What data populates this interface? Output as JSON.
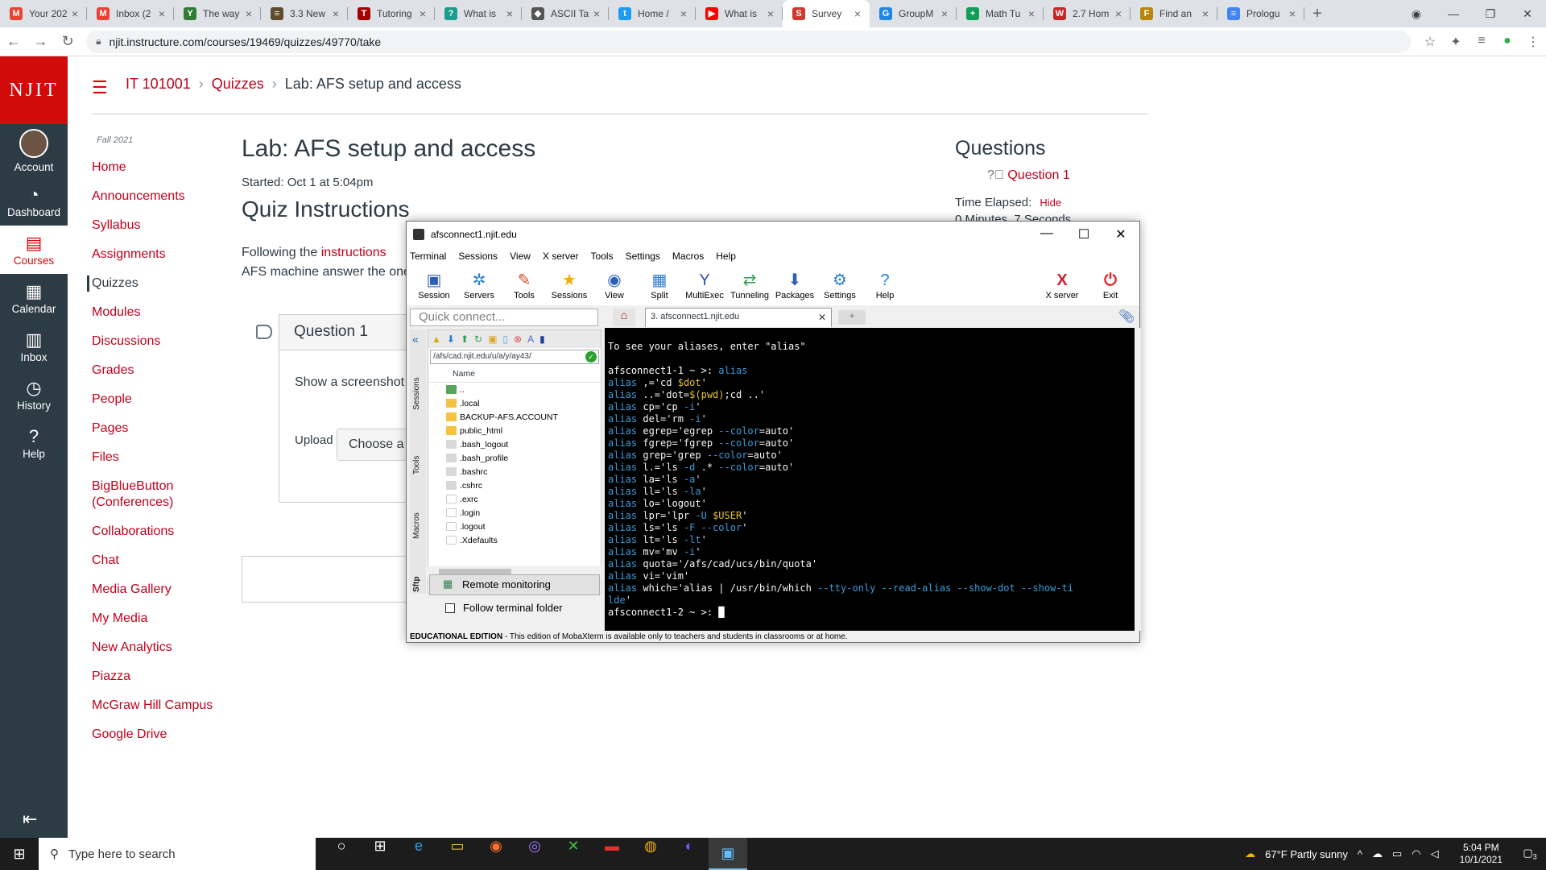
{
  "browser": {
    "tabs": [
      {
        "title": "Your 202",
        "fav": "M",
        "color": "#ea4335"
      },
      {
        "title": "Inbox (2",
        "fav": "M",
        "color": "#ea4335"
      },
      {
        "title": "The way",
        "fav": "Y",
        "color": "#2e7d32"
      },
      {
        "title": "3.3 New",
        "fav": "≡",
        "color": "#5f4b2e"
      },
      {
        "title": "Tutoring",
        "fav": "T",
        "color": "#a50000"
      },
      {
        "title": "What is",
        "fav": "?",
        "color": "#1a9c8c"
      },
      {
        "title": "ASCII Ta",
        "fav": "◆",
        "color": "#555555"
      },
      {
        "title": "Home /",
        "fav": "t",
        "color": "#1d9bf0"
      },
      {
        "title": "What is",
        "fav": "▶",
        "color": "#ff0000"
      },
      {
        "title": "Survey",
        "fav": "S",
        "color": "#d1392e"
      },
      {
        "title": "GroupM",
        "fav": "G",
        "color": "#1e88e5"
      },
      {
        "title": "Math Tu",
        "fav": "+",
        "color": "#0f9d58"
      },
      {
        "title": "2.7 Hom",
        "fav": "W",
        "color": "#c62828"
      },
      {
        "title": "Find an",
        "fav": "F",
        "color": "#b8860b"
      },
      {
        "title": "Prologu",
        "fav": "≡",
        "color": "#4285f4"
      }
    ],
    "url": "njit.instructure.com/courses/19469/quizzes/49770/take"
  },
  "global_nav": {
    "logo": "NJIT",
    "items": [
      {
        "label": "Account",
        "icon": "◯"
      },
      {
        "label": "Dashboard",
        "icon": "◔"
      },
      {
        "label": "Courses",
        "icon": "▤"
      },
      {
        "label": "Calendar",
        "icon": "▦"
      },
      {
        "label": "Inbox",
        "icon": "▥"
      },
      {
        "label": "History",
        "icon": "◷"
      },
      {
        "label": "Help",
        "icon": "?"
      }
    ]
  },
  "breadcrumb": {
    "course": "IT 101001",
    "section": "Quizzes",
    "page": "Lab: AFS setup and access"
  },
  "course_nav": {
    "term": "Fall 2021",
    "items": [
      "Home",
      "Announcements",
      "Syllabus",
      "Assignments",
      "Quizzes",
      "Modules",
      "Discussions",
      "Grades",
      "People",
      "Pages",
      "Files",
      "BigBlueButton (Conferences)",
      "Collaborations",
      "Chat",
      "Media Gallery",
      "My Media",
      "New Analytics",
      "Piazza",
      "McGraw Hill Campus",
      "Google Drive"
    ]
  },
  "quiz": {
    "title": "Lab: AFS setup and access",
    "started": "Started: Oct 1 at 5:04pm",
    "instructions_heading": "Quiz Instructions",
    "follow_prefix": "Following the ",
    "instructions_link": "instructions",
    "follow_rest": "AFS machine answer the one",
    "question_title": "Question 1",
    "question_text": "Show a screenshot",
    "upload_label": "Upload",
    "choose_button": "Choose a"
  },
  "sidebar": {
    "heading": "Questions",
    "question_link": "Question 1",
    "time_elapsed": "Time Elapsed:",
    "hide": "Hide",
    "elapsed_value": "0 Minutes, 7 Seconds"
  },
  "moba": {
    "title": "afsconnect1.njit.edu",
    "menu": [
      "Terminal",
      "Sessions",
      "View",
      "X server",
      "Tools",
      "Settings",
      "Macros",
      "Help"
    ],
    "toolbar": [
      {
        "label": "Session",
        "icon": "▣"
      },
      {
        "label": "Servers",
        "icon": "✲"
      },
      {
        "label": "Tools",
        "icon": "✎"
      },
      {
        "label": "Sessions",
        "icon": "★"
      },
      {
        "label": "View",
        "icon": "◉"
      },
      {
        "label": "Split",
        "icon": "▦"
      },
      {
        "label": "MultiExec",
        "icon": "Y"
      },
      {
        "label": "Tunneling",
        "icon": "⇄"
      },
      {
        "label": "Packages",
        "icon": "⬇"
      },
      {
        "label": "Settings",
        "icon": "⚙"
      },
      {
        "label": "Help",
        "icon": "?"
      }
    ],
    "toolbar_right": [
      {
        "label": "X server",
        "icon": "X"
      },
      {
        "label": "Exit",
        "icon": "⏻"
      }
    ],
    "quick_connect": "Quick connect...",
    "session_tab": "3. afsconnect1.njit.edu",
    "side_tabs": [
      "Sessions",
      "Tools",
      "Macros",
      "Sftp"
    ],
    "sftp_path": "/afs/cad.njit.edu/u/a/y/ay43/",
    "column_name": "Name",
    "files": [
      {
        "name": "..",
        "t": "u"
      },
      {
        "name": ".local",
        "t": "d"
      },
      {
        "name": "BACKUP-AFS.ACCOUNT",
        "t": "d"
      },
      {
        "name": "public_html",
        "t": "d"
      },
      {
        "name": ".bash_logout",
        "t": "f"
      },
      {
        "name": ".bash_profile",
        "t": "f"
      },
      {
        "name": ".bashrc",
        "t": "f"
      },
      {
        "name": ".cshrc",
        "t": "f"
      },
      {
        "name": ".exrc",
        "t": "w"
      },
      {
        "name": ".login",
        "t": "w"
      },
      {
        "name": ".logout",
        "t": "w"
      },
      {
        "name": ".Xdefaults",
        "t": "w"
      }
    ],
    "remote_monitoring": "Remote monitoring",
    "follow_folder": "Follow terminal folder",
    "status_bold": "EDUCATIONAL EDITION",
    "status_text": " - This edition of MobaXterm is available only to teachers and students in classrooms or at home.",
    "terminal_lines": [
      [
        {
          "t": "To see your aliases, enter \"alias\"",
          "c": "st"
        }
      ],
      [
        {
          "t": "",
          "c": "st"
        }
      ],
      [
        {
          "t": "afsconnect1-1 ~ >: ",
          "c": "pr"
        },
        {
          "t": "alias",
          "c": "kw"
        }
      ],
      [
        {
          "t": "alias ",
          "c": "kw"
        },
        {
          "t": ",='cd ",
          "c": "st"
        },
        {
          "t": "$dot",
          "c": "vr"
        },
        {
          "t": "'",
          "c": "st"
        }
      ],
      [
        {
          "t": "alias ",
          "c": "kw"
        },
        {
          "t": "..='dot=",
          "c": "st"
        },
        {
          "t": "$(pwd)",
          "c": "vr"
        },
        {
          "t": ";cd ..'",
          "c": "st"
        }
      ],
      [
        {
          "t": "alias ",
          "c": "kw"
        },
        {
          "t": "cp='cp ",
          "c": "st"
        },
        {
          "t": "-i",
          "c": "kw"
        },
        {
          "t": "'",
          "c": "st"
        }
      ],
      [
        {
          "t": "alias ",
          "c": "kw"
        },
        {
          "t": "del='rm ",
          "c": "st"
        },
        {
          "t": "-i",
          "c": "kw"
        },
        {
          "t": "'",
          "c": "st"
        }
      ],
      [
        {
          "t": "alias ",
          "c": "kw"
        },
        {
          "t": "egrep='egrep ",
          "c": "st"
        },
        {
          "t": "--color",
          "c": "kw"
        },
        {
          "t": "=auto'",
          "c": "st"
        }
      ],
      [
        {
          "t": "alias ",
          "c": "kw"
        },
        {
          "t": "fgrep='fgrep ",
          "c": "st"
        },
        {
          "t": "--color",
          "c": "kw"
        },
        {
          "t": "=auto'",
          "c": "st"
        }
      ],
      [
        {
          "t": "alias ",
          "c": "kw"
        },
        {
          "t": "grep='grep ",
          "c": "st"
        },
        {
          "t": "--color",
          "c": "kw"
        },
        {
          "t": "=auto'",
          "c": "st"
        }
      ],
      [
        {
          "t": "alias ",
          "c": "kw"
        },
        {
          "t": "l.='ls ",
          "c": "st"
        },
        {
          "t": "-d",
          "c": "kw"
        },
        {
          "t": " .* ",
          "c": "st"
        },
        {
          "t": "--color",
          "c": "kw"
        },
        {
          "t": "=auto'",
          "c": "st"
        }
      ],
      [
        {
          "t": "alias ",
          "c": "kw"
        },
        {
          "t": "la='ls ",
          "c": "st"
        },
        {
          "t": "-a",
          "c": "kw"
        },
        {
          "t": "'",
          "c": "st"
        }
      ],
      [
        {
          "t": "alias ",
          "c": "kw"
        },
        {
          "t": "ll='ls ",
          "c": "st"
        },
        {
          "t": "-la",
          "c": "kw"
        },
        {
          "t": "'",
          "c": "st"
        }
      ],
      [
        {
          "t": "alias ",
          "c": "kw"
        },
        {
          "t": "lo='logout'",
          "c": "st"
        }
      ],
      [
        {
          "t": "alias ",
          "c": "kw"
        },
        {
          "t": "lpr='lpr ",
          "c": "st"
        },
        {
          "t": "-U",
          "c": "kw"
        },
        {
          "t": " ",
          "c": "st"
        },
        {
          "t": "$USER",
          "c": "vr"
        },
        {
          "t": "'",
          "c": "st"
        }
      ],
      [
        {
          "t": "alias ",
          "c": "kw"
        },
        {
          "t": "ls='ls ",
          "c": "st"
        },
        {
          "t": "-F --color",
          "c": "kw"
        },
        {
          "t": "'",
          "c": "st"
        }
      ],
      [
        {
          "t": "alias ",
          "c": "kw"
        },
        {
          "t": "lt='ls ",
          "c": "st"
        },
        {
          "t": "-lt",
          "c": "kw"
        },
        {
          "t": "'",
          "c": "st"
        }
      ],
      [
        {
          "t": "alias ",
          "c": "kw"
        },
        {
          "t": "mv='mv ",
          "c": "st"
        },
        {
          "t": "-i",
          "c": "kw"
        },
        {
          "t": "'",
          "c": "st"
        }
      ],
      [
        {
          "t": "alias ",
          "c": "kw"
        },
        {
          "t": "quota='/afs/cad/ucs/bin/quota'",
          "c": "st"
        }
      ],
      [
        {
          "t": "alias ",
          "c": "kw"
        },
        {
          "t": "vi='vim'",
          "c": "st"
        }
      ],
      [
        {
          "t": "alias ",
          "c": "kw"
        },
        {
          "t": "which='alias | /usr/bin/which ",
          "c": "st"
        },
        {
          "t": "--tty-only --read-alias --show-dot --show-ti",
          "c": "kw"
        }
      ],
      [
        {
          "t": "lde",
          "c": "kw"
        },
        {
          "t": "'",
          "c": "st"
        }
      ],
      [
        {
          "t": "afsconnect1-2 ~ >: ",
          "c": "pr"
        },
        {
          "t": "█",
          "c": "pr"
        }
      ]
    ]
  },
  "taskbar": {
    "search_placeholder": "Type here to search",
    "apps": [
      "○",
      "⊞",
      "e",
      "▭",
      "◉",
      "◎",
      "✕",
      "▬",
      "◍",
      "◐",
      "▣"
    ],
    "weather": "67°F  Partly sunny",
    "time": "5:04 PM",
    "date": "10/1/2021",
    "notif_count": "3"
  }
}
